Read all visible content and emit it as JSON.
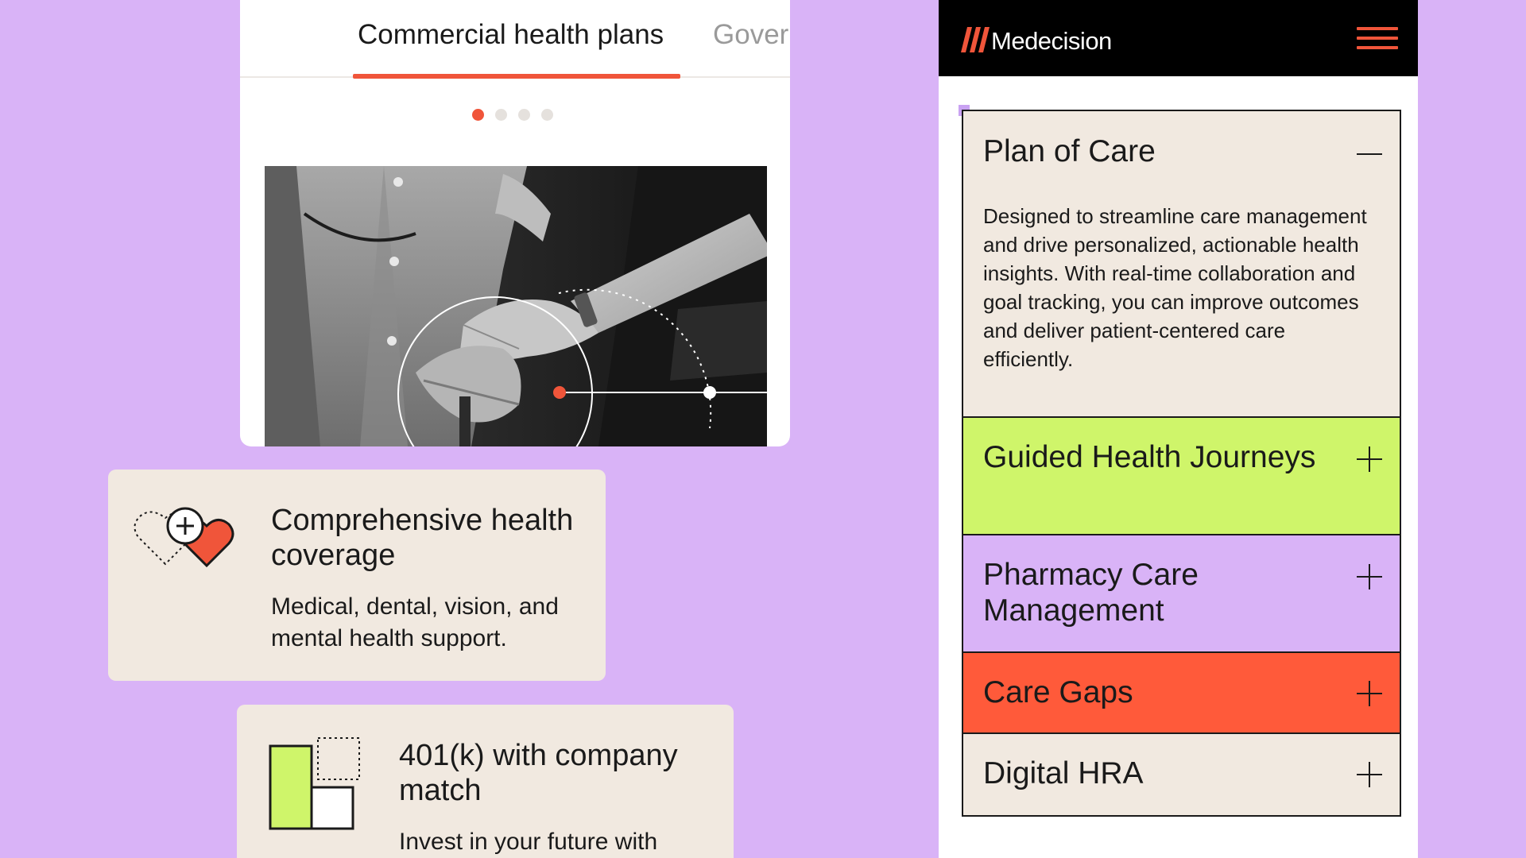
{
  "colors": {
    "background": "#d9b3f7",
    "accent": "#f0553a",
    "card": "#f1e9e0",
    "lime": "#cff56a",
    "lavender": "#d9b3f7",
    "coral": "#ff5a3a"
  },
  "tabs": {
    "items": [
      {
        "label": "Commercial health plans",
        "active": true
      },
      {
        "label": "Gover",
        "active": false
      }
    ],
    "pagination": {
      "count": 4,
      "active_index": 0
    }
  },
  "benefits": [
    {
      "icon": "hearts-plus-icon",
      "title": "Comprehensive health coverage",
      "description": "Medical, dental, vision, and mental health support."
    },
    {
      "icon": "savings-blocks-icon",
      "title": "401(k) with company match",
      "description": "Invest in your future with"
    }
  ],
  "app": {
    "brand": "Medecision",
    "menu_icon": "hamburger-menu-icon",
    "accordion": [
      {
        "title": "Plan of Care",
        "expanded": true,
        "toggle_icon": "minus-icon",
        "description": "Designed to streamline care management and drive personalized, actionable health insights. With real-time collaboration and goal tracking, you can improve outcomes and deliver patient-centered care efficiently."
      },
      {
        "title": "Guided Health Journeys",
        "expanded": false,
        "toggle_icon": "plus-icon"
      },
      {
        "title": "Pharmacy Care Management",
        "expanded": false,
        "toggle_icon": "plus-icon"
      },
      {
        "title": "Care Gaps",
        "expanded": false,
        "toggle_icon": "plus-icon"
      },
      {
        "title": "Digital HRA",
        "expanded": false,
        "toggle_icon": "plus-icon"
      }
    ]
  }
}
